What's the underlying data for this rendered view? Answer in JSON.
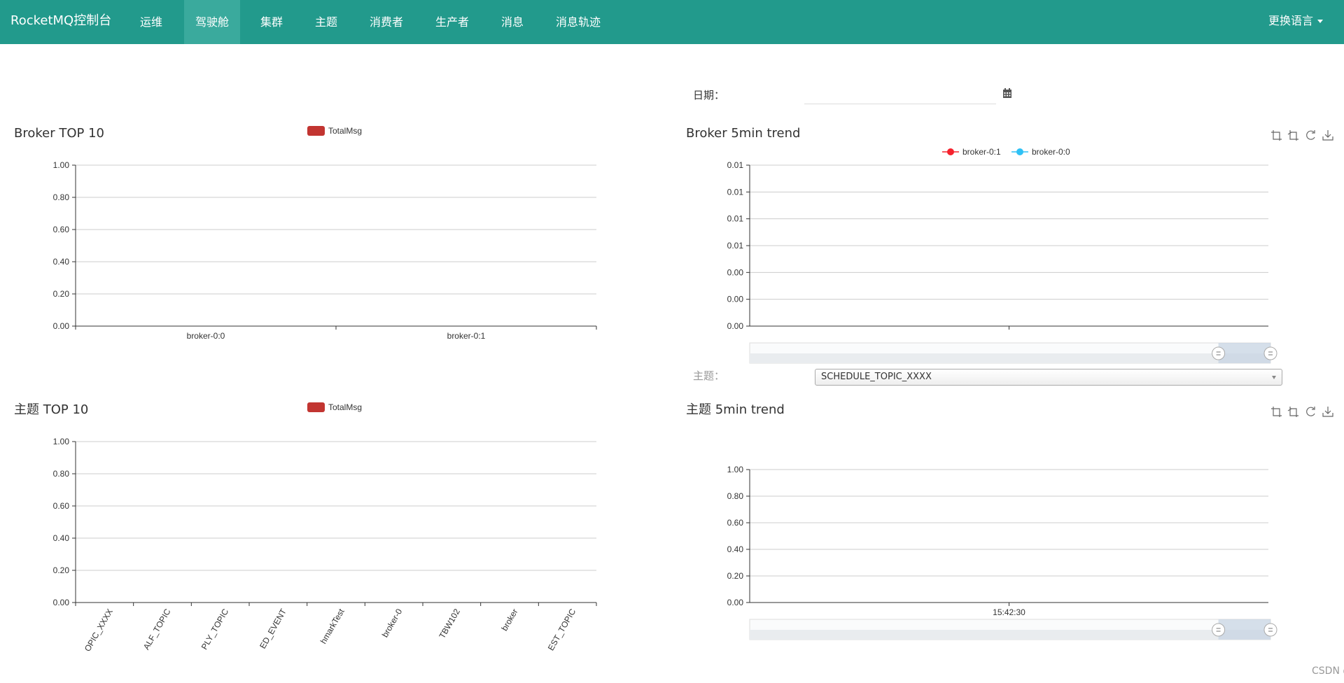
{
  "nav": {
    "brand": "RocketMQ控制台",
    "items": [
      {
        "label": "运维",
        "active": false
      },
      {
        "label": "驾驶舱",
        "active": true
      },
      {
        "label": "集群",
        "active": false
      },
      {
        "label": "主题",
        "active": false
      },
      {
        "label": "消费者",
        "active": false
      },
      {
        "label": "生产者",
        "active": false
      },
      {
        "label": "消息",
        "active": false
      },
      {
        "label": "消息轨迹",
        "active": false
      }
    ],
    "language": "更换语言"
  },
  "filters": {
    "date_label": "日期：",
    "date_value": "",
    "topic_label": "主题：",
    "topic_value": "SCHEDULE_TOPIC_XXXX"
  },
  "colors": {
    "navbar": "#229a8c",
    "bar": "#c23531",
    "line1": "#f5222d",
    "line2": "#2fc1f5"
  },
  "toolbox_icons": [
    "zoom-icon",
    "zoom-reset-icon",
    "restore-icon",
    "save-image-icon"
  ],
  "watermark": "CSDN @拾光·铼",
  "chart_data": [
    {
      "type": "bar",
      "title": "Broker TOP 10",
      "legend": [
        "TotalMsg"
      ],
      "categories": [
        "broker-0:0",
        "broker-0:1"
      ],
      "series": [
        {
          "name": "TotalMsg",
          "values": [
            0,
            0
          ]
        }
      ],
      "yticks": [
        "0.00",
        "0.20",
        "0.40",
        "0.60",
        "0.80",
        "1.00"
      ],
      "ylim": [
        0,
        1
      ],
      "grid": true,
      "legend_position": "top-center"
    },
    {
      "type": "line",
      "title": "Broker 5min trend",
      "legend": [
        "broker-0:1",
        "broker-0:0"
      ],
      "series": [
        {
          "name": "broker-0:1",
          "values": []
        },
        {
          "name": "broker-0:0",
          "values": []
        }
      ],
      "yticks": [
        "0.00",
        "0.00",
        "0.00",
        "0.01",
        "0.01",
        "0.01",
        "0.01"
      ],
      "grid": true,
      "legend_position": "top-center",
      "datazoom": [
        0.9,
        1.0
      ]
    },
    {
      "type": "bar",
      "title": "主题 TOP 10",
      "legend": [
        "TotalMsg"
      ],
      "categories": [
        "OPIC_XXXX",
        "ALF_TOPIC",
        "PLY_TOPIC",
        "ED_EVENT",
        "hmarkTest",
        "broker-0",
        "TBW102",
        "broker",
        "EST_TOPIC"
      ],
      "series": [
        {
          "name": "TotalMsg",
          "values": [
            0,
            0,
            0,
            0,
            0,
            0,
            0,
            0,
            0
          ]
        }
      ],
      "yticks": [
        "0.00",
        "0.20",
        "0.40",
        "0.60",
        "0.80",
        "1.00"
      ],
      "ylim": [
        0,
        1
      ],
      "grid": true,
      "legend_position": "top-center"
    },
    {
      "type": "line",
      "title": "主题 5min trend",
      "x": [
        "15:42:30"
      ],
      "series": [],
      "yticks": [
        "0.00",
        "0.20",
        "0.40",
        "0.60",
        "0.80",
        "1.00"
      ],
      "ylim": [
        0,
        1
      ],
      "grid": true,
      "datazoom": [
        0.9,
        1.0
      ]
    }
  ]
}
